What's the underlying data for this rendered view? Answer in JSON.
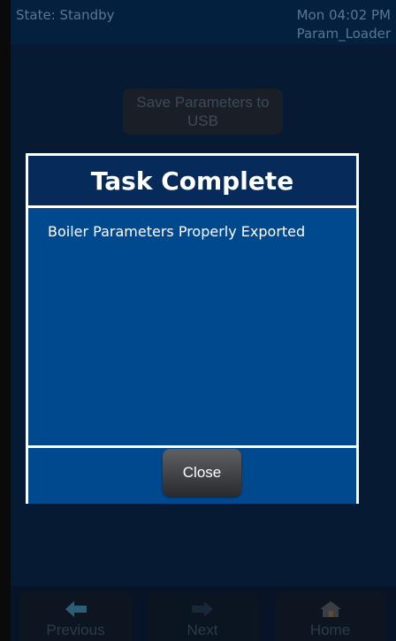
{
  "status": {
    "state": "State: Standby",
    "clock": "Mon 04:02 PM",
    "screen_name": "Param_Loader"
  },
  "main": {
    "save_button_label": "Save Parameters to USB"
  },
  "dialog": {
    "title": "Task Complete",
    "message": "Boiler Parameters Properly Exported",
    "close_label": "Close"
  },
  "nav": {
    "previous_label": "Previous",
    "next_label": "Next",
    "home_label": "Home",
    "previous_icon": "arrow-left-icon",
    "next_icon": "arrow-right-icon",
    "home_icon": "home-icon"
  },
  "colors": {
    "dialog_body": "#01498f",
    "dialog_header": "#062a5a",
    "background": "#061a33"
  }
}
